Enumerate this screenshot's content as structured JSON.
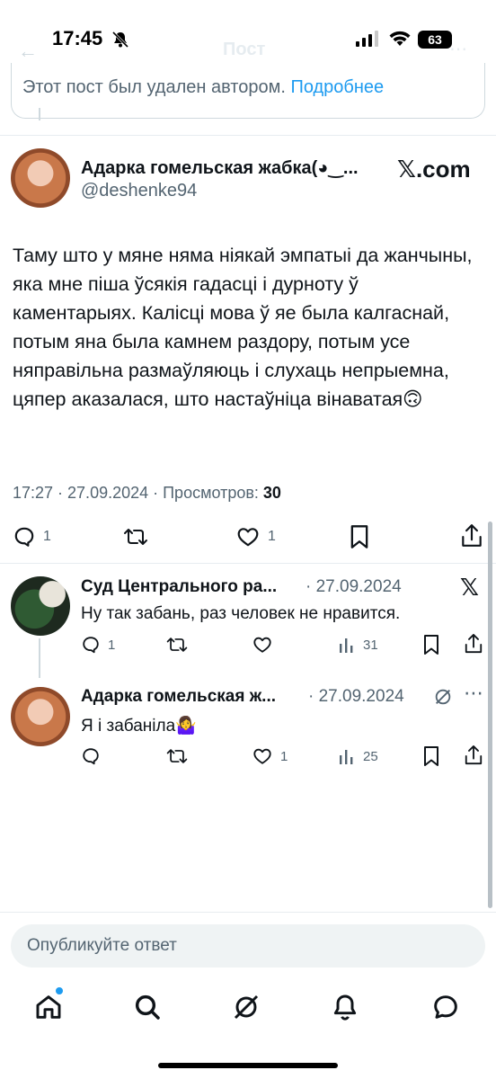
{
  "status_bar": {
    "time": "17:45",
    "battery": "63"
  },
  "header_ghost": {
    "title": "Пост"
  },
  "deleted_notice": {
    "text": "Этот пост был удален автором.",
    "link": "Подробнее"
  },
  "main_post": {
    "author_name": "Адарка гомельская жабка(◕‿...",
    "author_handle": "@deshenke94",
    "source_logo": "𝕏.com",
    "body": "Таму што у мяне няма ніякай эмпатыі да жанчыны, яка мне піша ўсякія гадасці і дурноту ў каментарыях. Калісці мова ў яе была калгаснай, потым яна была камнем раздору, потым усе няправільна размаўляюць і слухаць непрыемна, цяпер аказалася, што настаўніца вінаватая🙃",
    "meta_time": "17:27 · 27.09.2024 · Просмотров: ",
    "views": "30",
    "actions": {
      "replies": "1",
      "retweets": "",
      "likes": "1"
    }
  },
  "replies": [
    {
      "author_name": "Суд Центрального ра...",
      "date": "· 27.09.2024",
      "text": "Ну так забань, раз человек не нравится.",
      "replies": "1",
      "retweets": "",
      "likes": "",
      "views": "31"
    },
    {
      "author_name": "Адарка гомельская ж...",
      "date": "· 27.09.2024",
      "text": "Я і забаніла🤷‍♀️",
      "replies": "",
      "retweets": "",
      "likes": "1",
      "views": "25"
    }
  ],
  "composer": {
    "placeholder": "Опубликуйте ответ"
  },
  "icons": {
    "nav": [
      "home-icon",
      "search-icon",
      "grok-icon",
      "notifications-icon",
      "messages-icon"
    ]
  }
}
